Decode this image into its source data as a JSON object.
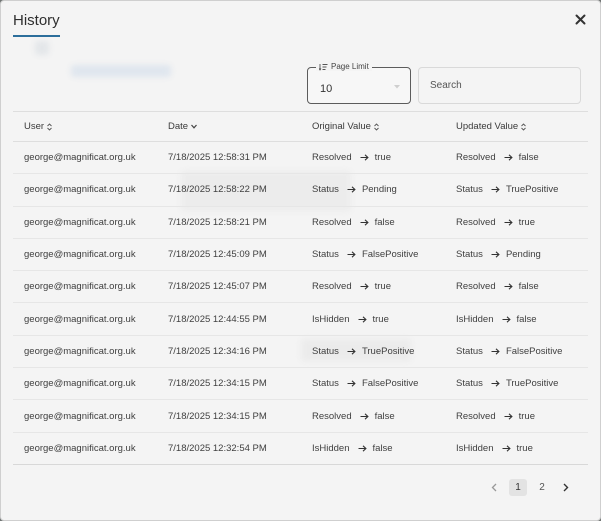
{
  "dialog": {
    "title": "History",
    "close_icon": "close-icon"
  },
  "controls": {
    "page_limit_label": "Page Limit",
    "page_limit_value": "10",
    "search_placeholder": "Search"
  },
  "table": {
    "headers": [
      "User",
      "Date",
      "Original Value",
      "Updated Value"
    ],
    "rows": [
      {
        "user": "george@magnificat.org.uk",
        "date": "7/18/2025 12:58:31 PM",
        "orig_field": "Resolved",
        "orig_val": "true",
        "upd_field": "Resolved",
        "upd_val": "false"
      },
      {
        "user": "george@magnificat.org.uk",
        "date": "7/18/2025 12:58:22 PM",
        "orig_field": "Status",
        "orig_val": "Pending",
        "upd_field": "Status",
        "upd_val": "TruePositive"
      },
      {
        "user": "george@magnificat.org.uk",
        "date": "7/18/2025 12:58:21 PM",
        "orig_field": "Resolved",
        "orig_val": "false",
        "upd_field": "Resolved",
        "upd_val": "true"
      },
      {
        "user": "george@magnificat.org.uk",
        "date": "7/18/2025 12:45:09 PM",
        "orig_field": "Status",
        "orig_val": "FalsePositive",
        "upd_field": "Status",
        "upd_val": "Pending"
      },
      {
        "user": "george@magnificat.org.uk",
        "date": "7/18/2025 12:45:07 PM",
        "orig_field": "Resolved",
        "orig_val": "true",
        "upd_field": "Resolved",
        "upd_val": "false"
      },
      {
        "user": "george@magnificat.org.uk",
        "date": "7/18/2025 12:44:55 PM",
        "orig_field": "IsHidden",
        "orig_val": "true",
        "upd_field": "IsHidden",
        "upd_val": "false"
      },
      {
        "user": "george@magnificat.org.uk",
        "date": "7/18/2025 12:34:16 PM",
        "orig_field": "Status",
        "orig_val": "TruePositive",
        "upd_field": "Status",
        "upd_val": "FalsePositive"
      },
      {
        "user": "george@magnificat.org.uk",
        "date": "7/18/2025 12:34:15 PM",
        "orig_field": "Status",
        "orig_val": "FalsePositive",
        "upd_field": "Status",
        "upd_val": "TruePositive"
      },
      {
        "user": "george@magnificat.org.uk",
        "date": "7/18/2025 12:34:15 PM",
        "orig_field": "Resolved",
        "orig_val": "false",
        "upd_field": "Resolved",
        "upd_val": "true"
      },
      {
        "user": "george@magnificat.org.uk",
        "date": "7/18/2025 12:32:54 PM",
        "orig_field": "IsHidden",
        "orig_val": "false",
        "upd_field": "IsHidden",
        "upd_val": "true"
      }
    ]
  },
  "pagination": {
    "pages": [
      "1",
      "2"
    ],
    "current": "1"
  },
  "colors": {
    "accent": "#2c6e9b",
    "dialog_bg": "#f4f4f4"
  }
}
